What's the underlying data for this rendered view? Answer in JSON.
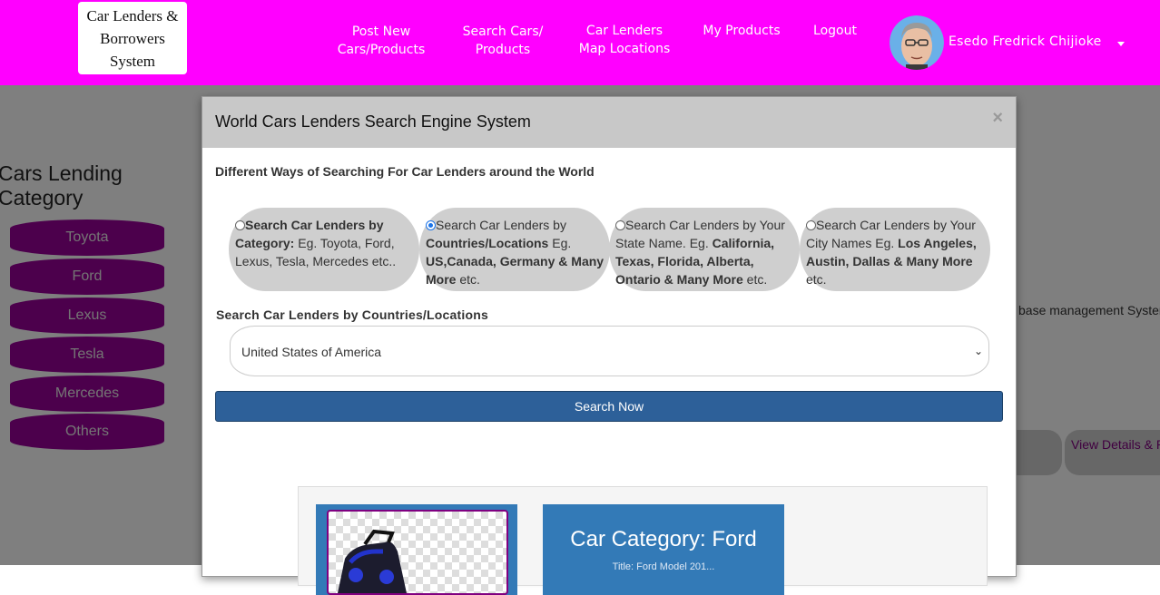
{
  "brand": {
    "line1": "Car Lenders &",
    "line2": "Borrowers System"
  },
  "nav": {
    "post_new": [
      "Post New",
      "Cars/Products"
    ],
    "search_cars": [
      "Search Cars/",
      "Products"
    ],
    "map_locations": [
      "Car Lenders",
      "Map Locations"
    ],
    "my_products": "My Products",
    "logout": "Logout",
    "user_name": "Esedo Fredrick Chijioke"
  },
  "sidebar": {
    "title": [
      "Cars Lending",
      "Category"
    ],
    "categories": [
      "Toyota",
      "Ford",
      "Lexus",
      "Tesla",
      "Mercedes",
      "Others"
    ]
  },
  "background": {
    "right_text": "base management System",
    "view_details": "View Details & P"
  },
  "modal": {
    "title": "World Cars Lenders Search Engine System",
    "close": "×",
    "subtitle": "Different Ways of Searching For Car Lenders around the World",
    "options": [
      {
        "checked": false,
        "parts": [
          [
            "b",
            "Search Car Lenders by Category:"
          ],
          [
            "t",
            " Eg. Toyota, Ford, Lexus, Tesla, Mercedes etc.."
          ]
        ]
      },
      {
        "checked": true,
        "parts": [
          [
            "t",
            "Search Car Lenders by "
          ],
          [
            "b",
            "Countries/Locations"
          ],
          [
            "t",
            " Eg. "
          ],
          [
            "b",
            "US,Canada, Germany & Many More"
          ],
          [
            "t",
            " etc."
          ]
        ]
      },
      {
        "checked": false,
        "parts": [
          [
            "t",
            "Search Car Lenders by Your State Name. Eg. "
          ],
          [
            "b",
            "California, Texas, Florida, Alberta, Ontario & Many More"
          ],
          [
            "t",
            " etc."
          ]
        ]
      },
      {
        "checked": false,
        "parts": [
          [
            "t",
            "Search Car Lenders by Your City Names Eg. "
          ],
          [
            "b",
            "Los Angeles, Austin, Dallas & Many More"
          ],
          [
            "t",
            " etc."
          ]
        ]
      }
    ],
    "select_label": "Search Car Lenders by Countries/Locations",
    "select_value": "United States of America",
    "search_button": "Search Now",
    "card_title": "Car Category: Ford",
    "card_sub": "Title: Ford Model 201..."
  }
}
